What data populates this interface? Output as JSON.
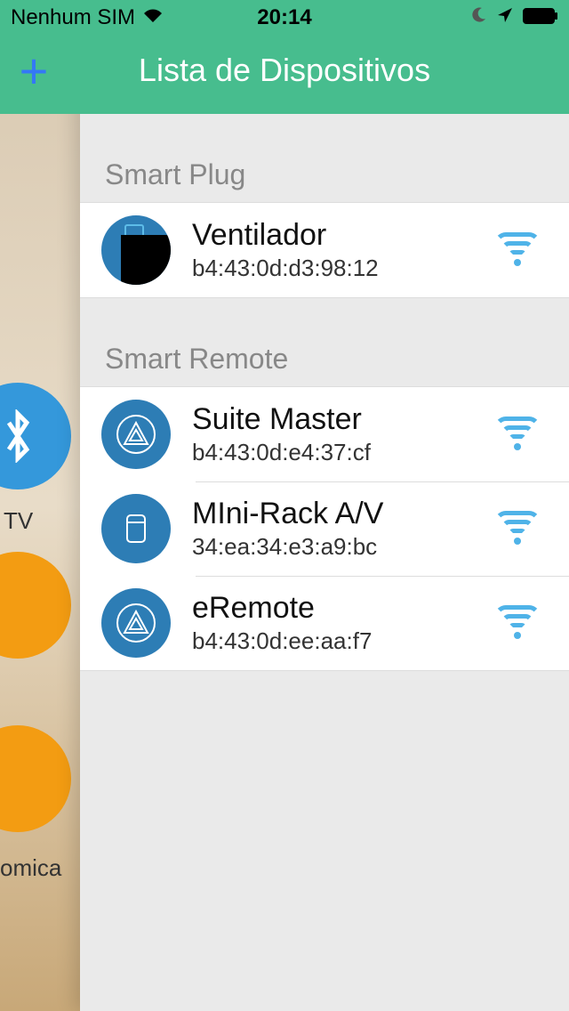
{
  "status_bar": {
    "carrier": "Nenhum SIM",
    "time": "20:14"
  },
  "header": {
    "title": "Lista de Dispositivos",
    "add_label": "+"
  },
  "sections": [
    {
      "title": "Smart Plug",
      "devices": [
        {
          "name": "Ventilador",
          "mac": "b4:43:0d:d3:98:12",
          "icon": "plug"
        }
      ]
    },
    {
      "title": "Smart Remote",
      "devices": [
        {
          "name": "Suite Master",
          "mac": "b4:43:0d:e4:37:cf",
          "icon": "remote-triangle"
        },
        {
          "name": "MIni-Rack A/V",
          "mac": "34:ea:34:e3:a9:bc",
          "icon": "remote-rect"
        },
        {
          "name": "eRemote",
          "mac": "b4:43:0d:ee:aa:f7",
          "icon": "remote-triangle"
        }
      ]
    }
  ],
  "bg_labels": {
    "tv": "TV",
    "omica": "omica"
  },
  "colors": {
    "accent": "#47BD8E",
    "icon_blue": "#2d7db5",
    "wifi": "#4fb3e8"
  }
}
